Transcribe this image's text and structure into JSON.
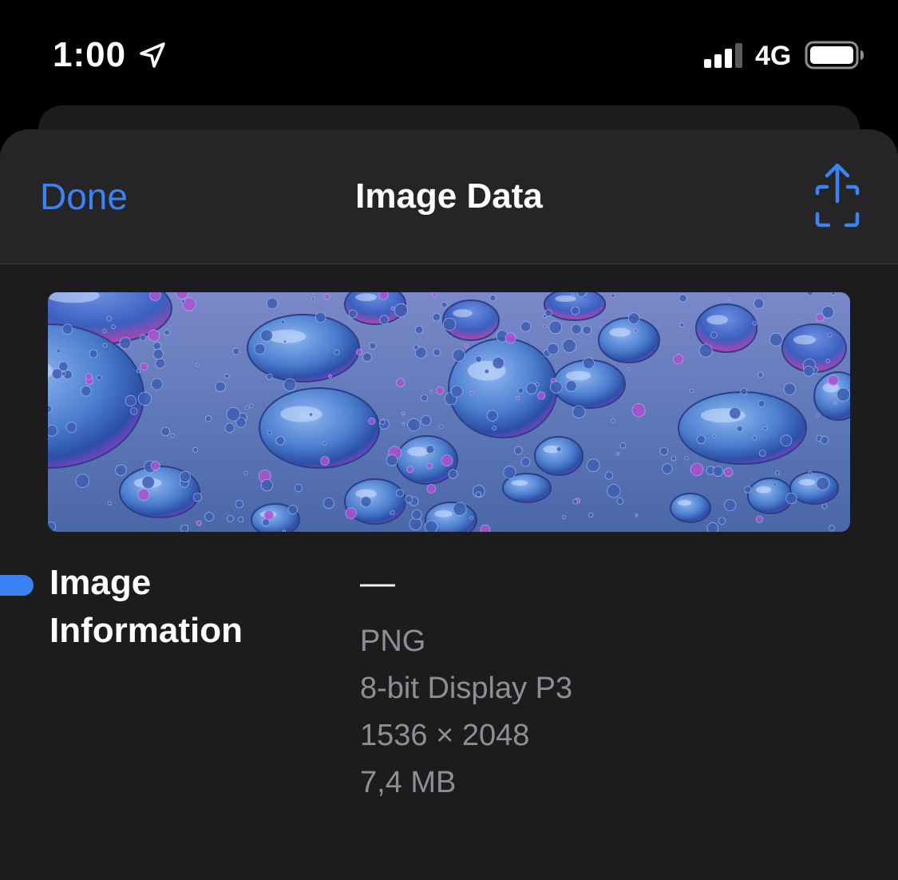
{
  "status_bar": {
    "time": "1:00",
    "network": "4G",
    "icons": [
      "location-arrow-icon",
      "signal-bars-icon",
      "battery-icon"
    ]
  },
  "header": {
    "done_label": "Done",
    "title": "Image Data",
    "share_icon": "share-icon"
  },
  "colors": {
    "accent": "#3b82f6",
    "sheet_background": "#1c1c1e",
    "nav_background": "#252527",
    "secondary_text": "#8e8e93"
  },
  "info": {
    "section_title": "Image Information",
    "dash": "—",
    "format": "PNG",
    "color_profile": "8-bit Display P3",
    "dimensions": "1536 × 2048",
    "file_size": "7,4 MB"
  }
}
